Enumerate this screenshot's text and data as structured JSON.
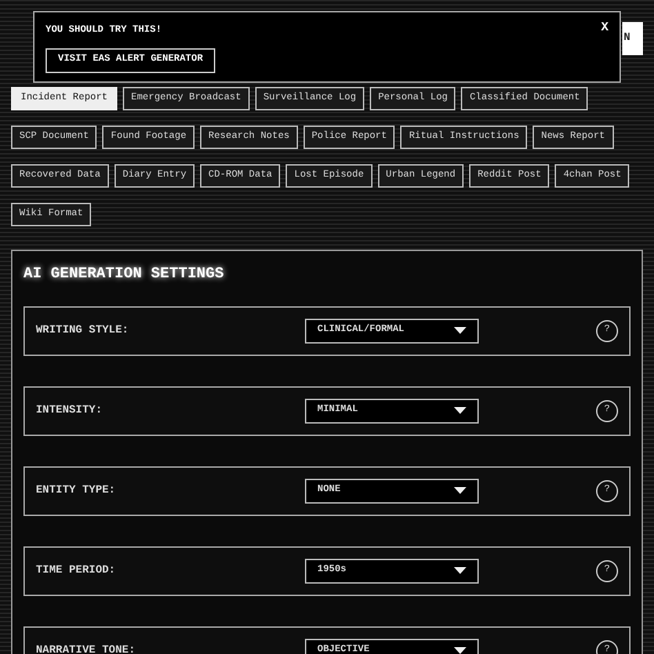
{
  "header": {
    "mobile_mode_button": "N"
  },
  "popup": {
    "message": "YOU SHOULD TRY THIS!",
    "button": "VISIT EAS ALERT GENERATOR",
    "close": "X"
  },
  "formats": [
    {
      "label": "Incident Report",
      "selected": true
    },
    {
      "label": "Emergency Broadcast",
      "selected": false
    },
    {
      "label": "Surveillance Log",
      "selected": false
    },
    {
      "label": "Personal Log",
      "selected": false
    },
    {
      "label": "Classified Document",
      "selected": false
    },
    {
      "label": "SCP Document",
      "selected": false
    },
    {
      "label": "Found Footage",
      "selected": false
    },
    {
      "label": "Research Notes",
      "selected": false
    },
    {
      "label": "Police Report",
      "selected": false
    },
    {
      "label": "Ritual Instructions",
      "selected": false
    },
    {
      "label": "News Report",
      "selected": false
    },
    {
      "label": "Recovered Data",
      "selected": false
    },
    {
      "label": "Diary Entry",
      "selected": false
    },
    {
      "label": "CD-ROM Data",
      "selected": false
    },
    {
      "label": "Lost Episode",
      "selected": false
    },
    {
      "label": "Urban Legend",
      "selected": false
    },
    {
      "label": "Reddit Post",
      "selected": false
    },
    {
      "label": "4chan Post",
      "selected": false
    },
    {
      "label": "Wiki Format",
      "selected": false
    }
  ],
  "settings": {
    "title": "AI GENERATION SETTINGS",
    "rows": [
      {
        "label": "WRITING STYLE:",
        "value": "CLINICAL/FORMAL",
        "help": "?"
      },
      {
        "label": "INTENSITY:",
        "value": "MINIMAL",
        "help": "?"
      },
      {
        "label": "ENTITY TYPE:",
        "value": "NONE",
        "help": "?"
      },
      {
        "label": "TIME PERIOD:",
        "value": "1950s",
        "help": "?"
      },
      {
        "label": "NARRATIVE TONE:",
        "value": "OBJECTIVE",
        "help": "?"
      }
    ]
  }
}
